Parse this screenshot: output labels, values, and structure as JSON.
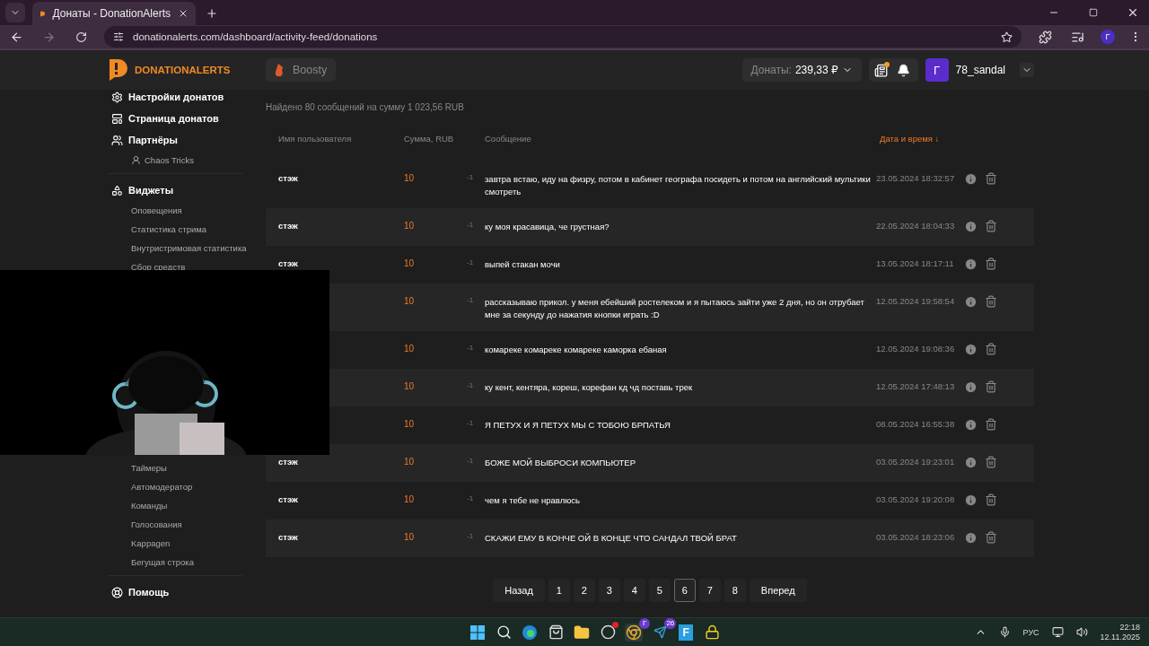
{
  "browser": {
    "tab_title": "Донаты - DonationAlerts",
    "url": "donationalerts.com/dashboard/activity-feed/donations",
    "profile_letter": "Г"
  },
  "header": {
    "brand": "DONATIONALERTS",
    "boosty": "Boosty",
    "donations_label": "Донаты:",
    "donations_amount": "239,33 ₽",
    "news_unread": true,
    "avatar_letter": "Г",
    "username": "78_sandal"
  },
  "sidebar": {
    "sections": [
      {
        "label": "Настройки донатов"
      },
      {
        "label": "Страница донатов"
      },
      {
        "label": "Партнёры",
        "children": [
          {
            "label": "Chaos Tricks"
          }
        ]
      },
      {
        "label": "Виджеты",
        "children": [
          {
            "label": "Оповещения"
          },
          {
            "label": "Статистика стрима"
          },
          {
            "label": "Внутристримовая статистика"
          },
          {
            "label": "Сбор средств"
          },
          {
            "kind": "hidden"
          },
          {
            "label": "Таймеры"
          },
          {
            "label": "Автомодератор"
          },
          {
            "label": "Команды"
          },
          {
            "label": "Голосования"
          },
          {
            "label": "Kappagen"
          },
          {
            "label": "Бегущая строка"
          }
        ]
      },
      {
        "label": "Помощь"
      }
    ]
  },
  "summary": "Найдено 80 сообщений на сумму 1 023,56 RUB",
  "table": {
    "columns": [
      {
        "label": "Имя пользователя",
        "sorted": false
      },
      {
        "label": "Сумма, RUB",
        "sorted": false
      },
      {
        "label": "Сообщение",
        "sorted": false
      },
      {
        "label": "Дата и время ↓",
        "sorted": true
      }
    ],
    "rows": [
      {
        "user": "стэж",
        "amount": "10",
        "delta": "-1",
        "message": "завтра встаю, иду на физру, потом в кабинет географа посидеть и потом на английский мультики смотреть",
        "date": "23.05.2024 18:32:57"
      },
      {
        "user": "стэж",
        "amount": "10",
        "delta": "-1",
        "message": "ку моя красавица, че грустная?",
        "date": "22.05.2024 18:04:33"
      },
      {
        "user": "стэж",
        "amount": "10",
        "delta": "-1",
        "message": "выпей стакан мочи",
        "date": "13.05.2024 18:17:11"
      },
      {
        "amount": "10",
        "delta": "-1",
        "message": "рассказываю прикол. у меня ебейший ростелеком и я пытаюсь зайти уже 2 дня, но он отрубает мне за секунду до нажатия кнопки играть :D",
        "date": "12.05.2024 19:58:54"
      },
      {
        "amount": "10",
        "delta": "-1",
        "message": "комареке комареке комареке каморка ебаная",
        "date": "12.05.2024 19:08:36"
      },
      {
        "amount": "10",
        "delta": "-1",
        "message": "ку кент, кентяра, кореш, корефан кд чд поставь трек",
        "date": "12.05.2024 17:48:13"
      },
      {
        "amount": "10",
        "delta": "-1",
        "message": "Я ПЕТУХ И Я ПЕТУХ МЫ С ТОБОЮ БРПАТЬЯ",
        "date": "08.05.2024 16:55:38"
      },
      {
        "user": "стэж",
        "amount": "10",
        "delta": "-1",
        "message": "БОЖЕ МОЙ ВЫБРОСИ КОМПЬЮТЕР",
        "date": "03.05.2024 19:23:01"
      },
      {
        "user": "стэж",
        "amount": "10",
        "delta": "-1",
        "message": "чем я тебе не нравлюсь",
        "date": "03.05.2024 19:20:08"
      },
      {
        "user": "стэж",
        "amount": "10",
        "delta": "-1",
        "message": "СКАЖИ ЕМУ В КОНЧЕ ОЙ В КОНЦЕ ЧТО САНДАЛ ТВОЙ БРАТ",
        "date": "03.05.2024 18:23:06"
      }
    ]
  },
  "pagination": {
    "prev": "Назад",
    "next": "Вперед",
    "pages": [
      {
        "label": "1",
        "selected": false
      },
      {
        "label": "2",
        "selected": false
      },
      {
        "label": "3",
        "selected": false
      },
      {
        "label": "4",
        "selected": false
      },
      {
        "label": "5",
        "selected": false
      },
      {
        "label": "6",
        "selected": true
      },
      {
        "label": "7",
        "selected": false
      },
      {
        "label": "8",
        "selected": false
      }
    ]
  },
  "taskbar": {
    "apps": [
      {
        "kind": "windows"
      },
      {
        "kind": "search"
      },
      {
        "kind": "edge"
      },
      {
        "kind": "store"
      },
      {
        "kind": "folder"
      },
      {
        "kind": "obs",
        "alert": true
      },
      {
        "kind": "chrome",
        "badge": "Г"
      },
      {
        "kind": "telegram",
        "badge": "26"
      },
      {
        "kind": "letter",
        "label": "F"
      },
      {
        "kind": "lock"
      }
    ],
    "language": "РУС",
    "time": "22:18",
    "date": "12.11.2025"
  }
}
